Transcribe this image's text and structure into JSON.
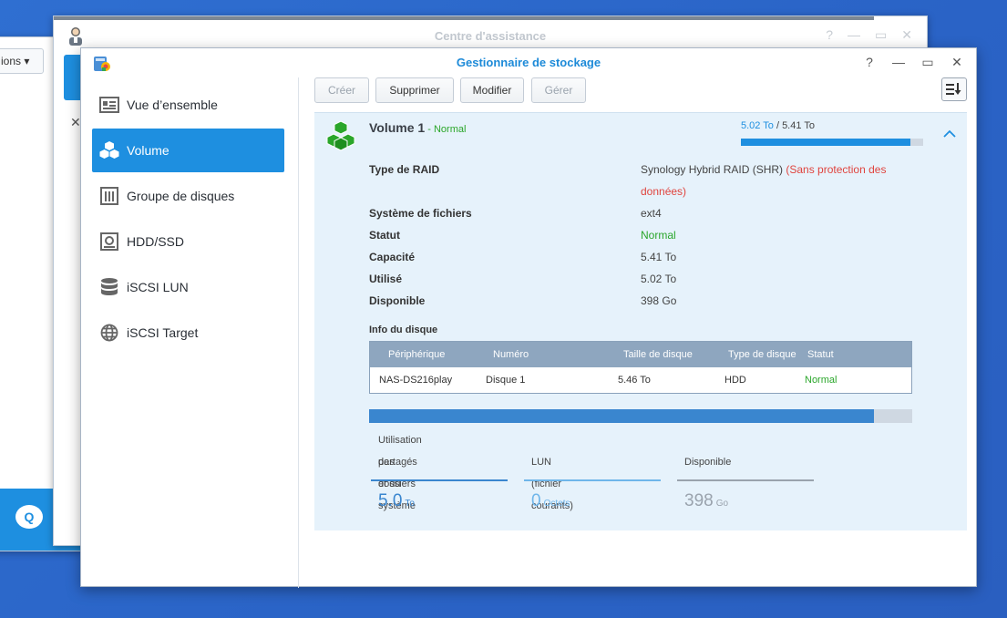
{
  "bg_window": {
    "options_label": "ions"
  },
  "assist_window": {
    "title": "Centre d'assistance",
    "ctrl_help": "?",
    "ctrl_min": "—",
    "ctrl_max": "▭",
    "ctrl_close": "✕"
  },
  "main_window": {
    "title": "Gestionnaire de stockage",
    "ctrl_help": "?",
    "ctrl_min": "—",
    "ctrl_max": "▭",
    "ctrl_close": "✕"
  },
  "sidebar": {
    "items": [
      {
        "label": "Vue d’ensemble",
        "icon": "overview-icon"
      },
      {
        "label": "Volume",
        "icon": "volume-cubes-icon",
        "active": true
      },
      {
        "label": "Groupe de disques",
        "icon": "disk-group-icon"
      },
      {
        "label": "HDD/SSD",
        "icon": "hdd-icon"
      },
      {
        "label": "iSCSI LUN",
        "icon": "database-icon"
      },
      {
        "label": "iSCSI Target",
        "icon": "globe-icon"
      }
    ]
  },
  "toolbar": {
    "create": "Créer",
    "delete": "Supprimer",
    "edit": "Modifier",
    "manage": "Gérer"
  },
  "volume": {
    "name": "Volume 1",
    "status_suffix": " - Normal",
    "used": "5.02 To",
    "sep": " / ",
    "total": "5.41 To",
    "used_fraction": 0.93,
    "props": [
      {
        "key": "Type de RAID",
        "value": "Synology Hybrid RAID (SHR) ",
        "value_extra": "(Sans protection des données)"
      },
      {
        "key": "Système de fichiers",
        "value": "ext4"
      },
      {
        "key": "Statut",
        "value": "Normal"
      },
      {
        "key": "Capacité",
        "value": "5.41 To"
      },
      {
        "key": "Utilisé",
        "value": "5.02 To"
      },
      {
        "key": "Disponible",
        "value": "398 Go"
      }
    ]
  },
  "disk_info": {
    "title": "Info du disque",
    "headers": [
      "Périphérique",
      "Numéro",
      "Taille de disque",
      "Type de disque",
      "Statut"
    ],
    "rows": [
      [
        "NAS-DS216play",
        "Disque 1",
        "5.46 To",
        "HDD",
        "Normal"
      ]
    ]
  },
  "usage": {
    "fill_fraction": 0.93,
    "stats": [
      {
        "label1": "Utilisation des dossiers",
        "label2": "partagés et du système",
        "value": "5.0",
        "unit": "To",
        "color": "#3a86cf"
      },
      {
        "label1": "",
        "label2": "LUN (fichier courants)",
        "value": "0",
        "unit": "Octets",
        "color": "#6fb6ea"
      },
      {
        "label1": "",
        "label2": "Disponible",
        "value": "398",
        "unit": "Go",
        "color": "#9aa3ad"
      }
    ]
  },
  "colors": {
    "accent": "#1e8fe0",
    "ok": "#2aa62a",
    "warn": "#e0443e",
    "panel": "#e6f2fb"
  }
}
